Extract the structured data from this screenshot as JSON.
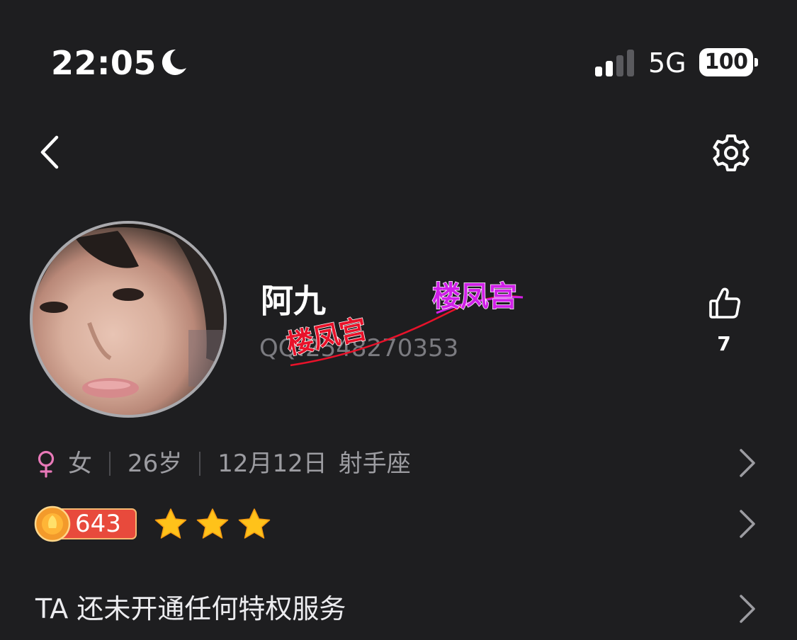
{
  "status_bar": {
    "time": "22:05",
    "network": "5G",
    "battery": "100",
    "icons": [
      "moon-icon",
      "signal-icon"
    ]
  },
  "nav": {
    "icons": [
      "back-icon",
      "gear-icon"
    ]
  },
  "profile": {
    "nickname": "阿九",
    "qq": "QQ:2548270353",
    "likes": "7",
    "gender_symbol": "♀",
    "gender": "女",
    "age": "26岁",
    "birthday": "12月12日",
    "constellation": "射手座"
  },
  "level": {
    "value": "643",
    "stars": 3
  },
  "privilege": {
    "text": "TA 还未开通任何特权服务"
  },
  "watermark": {
    "text_upper": "楼凤宫",
    "text_lower": "楼凤宫"
  },
  "colors": {
    "background": "#1e1e20",
    "secondary_text": "#9c9ca1",
    "female_pink": "#e879b8",
    "level_red": "#e84a3c",
    "star_gold": "#ffc21a",
    "watermark_magenta": "#d020e8",
    "watermark_red": "#e8122a"
  }
}
